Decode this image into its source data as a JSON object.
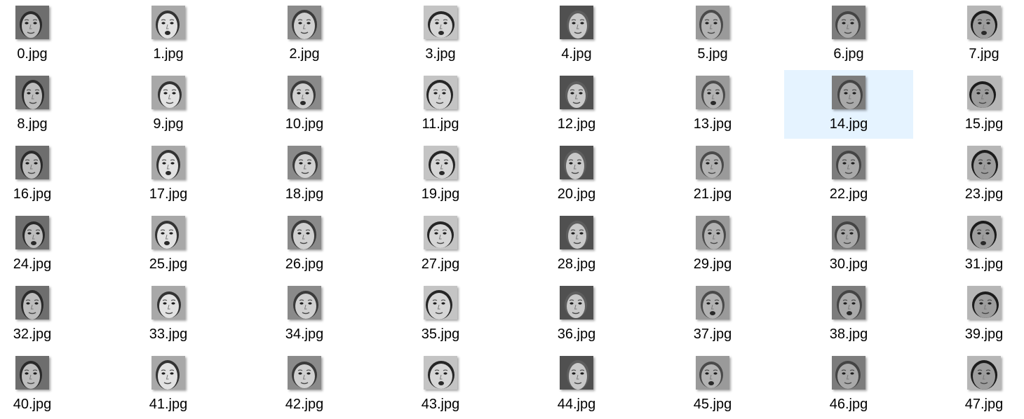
{
  "folder_view": {
    "view_mode": "medium-icons",
    "selected_file": "14.jpg",
    "selection_color": "#e5f3ff",
    "thumbnail_icon": "grayscale-face-photo-icon",
    "files": [
      {
        "name": "0.jpg"
      },
      {
        "name": "1.jpg"
      },
      {
        "name": "2.jpg"
      },
      {
        "name": "3.jpg"
      },
      {
        "name": "4.jpg"
      },
      {
        "name": "5.jpg"
      },
      {
        "name": "6.jpg"
      },
      {
        "name": "7.jpg"
      },
      {
        "name": "8.jpg"
      },
      {
        "name": "9.jpg"
      },
      {
        "name": "10.jpg"
      },
      {
        "name": "11.jpg"
      },
      {
        "name": "12.jpg"
      },
      {
        "name": "13.jpg"
      },
      {
        "name": "14.jpg"
      },
      {
        "name": "15.jpg"
      },
      {
        "name": "16.jpg"
      },
      {
        "name": "17.jpg"
      },
      {
        "name": "18.jpg"
      },
      {
        "name": "19.jpg"
      },
      {
        "name": "20.jpg"
      },
      {
        "name": "21.jpg"
      },
      {
        "name": "22.jpg"
      },
      {
        "name": "23.jpg"
      },
      {
        "name": "24.jpg"
      },
      {
        "name": "25.jpg"
      },
      {
        "name": "26.jpg"
      },
      {
        "name": "27.jpg"
      },
      {
        "name": "28.jpg"
      },
      {
        "name": "29.jpg"
      },
      {
        "name": "30.jpg"
      },
      {
        "name": "31.jpg"
      },
      {
        "name": "32.jpg"
      },
      {
        "name": "33.jpg"
      },
      {
        "name": "34.jpg"
      },
      {
        "name": "35.jpg"
      },
      {
        "name": "36.jpg"
      },
      {
        "name": "37.jpg"
      },
      {
        "name": "38.jpg"
      },
      {
        "name": "39.jpg"
      },
      {
        "name": "40.jpg"
      },
      {
        "name": "41.jpg"
      },
      {
        "name": "42.jpg"
      },
      {
        "name": "43.jpg"
      },
      {
        "name": "44.jpg"
      },
      {
        "name": "45.jpg"
      },
      {
        "name": "46.jpg"
      },
      {
        "name": "47.jpg"
      }
    ]
  }
}
